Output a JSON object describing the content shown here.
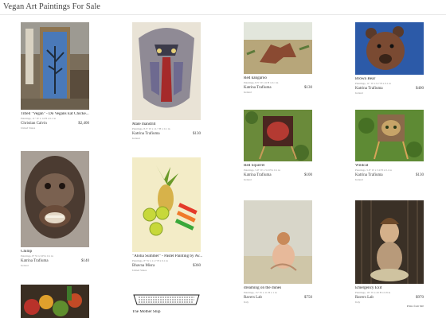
{
  "page": {
    "title": "Vegan Art Paintings For Sale"
  },
  "items": [
    {
      "name": "Titled \"Vegan\" - Do Vegans Eat Chicke...",
      "meta": "Paintings, 11\" W x 14 H x 0.1 in",
      "artist": "Christian Calvin",
      "price": "$2,400",
      "location": "United States"
    },
    {
      "name": "Chimp",
      "meta": "Paintings, 8\" W x 6 H x 0.1 in",
      "artist": "Katrina Trafiuma",
      "price": "$140",
      "location": "Ireland"
    },
    {
      "name": "Male mandrill",
      "meta": "Paintings, 8.3\" W x 11.7 H x 0.1 in",
      "artist": "Katrina Trafiuma",
      "price": "$130",
      "location": "Ireland"
    },
    {
      "name": "\"Aloha Summer\" - Pastel Painting by Av...",
      "meta": "Paintings, 8\" W x 11.7 H x 0.1 in",
      "artist": "Bhavna Misra",
      "price": "$360",
      "location": "United States"
    },
    {
      "name": "The Mother Ship"
    },
    {
      "name": "Red kangaroo",
      "meta": "Paintings, 8.5\" W x 6 H x 0.1 in",
      "artist": "Katrina Trafiuma",
      "price": "$130",
      "location": "Ireland"
    },
    {
      "name": "Red Squirrel",
      "meta": "Paintings, 5.9\" W x 5.9 H x 0.1 in",
      "artist": "Katrina Trafiuma",
      "price": "$100",
      "location": "Ireland"
    },
    {
      "name": "dreaming on the dunes",
      "meta": "Paintings, 15\" W x 11 H x 1 in",
      "artist": "Ravers Lab",
      "price": "$750",
      "location": "Italy"
    },
    {
      "name": "Brown Bear",
      "meta": "Paintings, 11\" W x 9.7 H x 0.1 in",
      "artist": "Katrina Trafiuma",
      "price": "$400",
      "location": "Ireland"
    },
    {
      "name": "Wildcat",
      "meta": "Paintings, 5.9\" W x 5.9 H x 0.1 in",
      "artist": "Katrina Trafiuma",
      "price": "$130",
      "location": "Ireland"
    },
    {
      "name": "Emergency Exit",
      "meta": "Paintings, 16\" W x 20 H x 0.8 in",
      "artist": "Ravers Lab",
      "price": "$970",
      "location": "Italy",
      "extra": "Prints from $40"
    }
  ]
}
